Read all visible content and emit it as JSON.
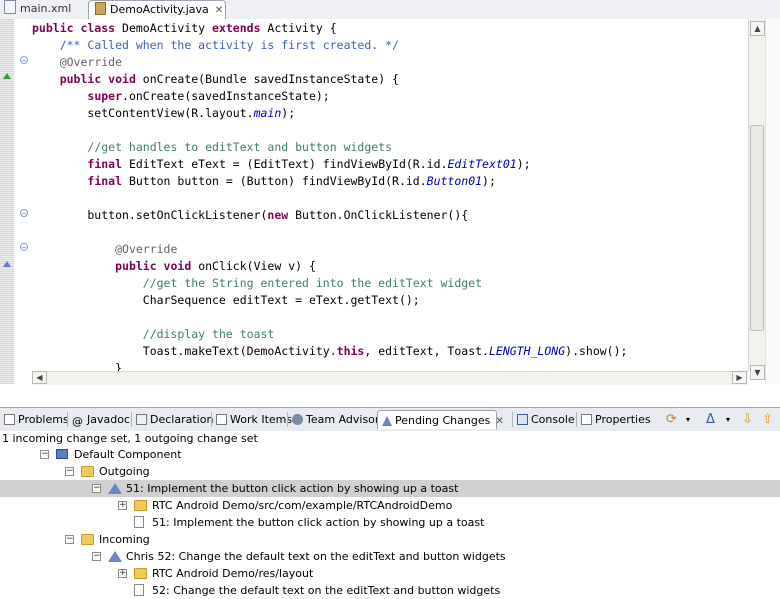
{
  "editor_tabs": [
    {
      "label": "main.xml"
    },
    {
      "label": "DemoActivity.java"
    }
  ],
  "code_lines": [
    [
      {
        "t": "public class",
        "c": "kw"
      },
      {
        "t": " DemoActivity "
      },
      {
        "t": "extends",
        "c": "kw"
      },
      {
        "t": " Activity {"
      }
    ],
    [
      {
        "t": "    "
      },
      {
        "t": "/** Called when the activity is first created. */",
        "c": "jd"
      }
    ],
    [
      {
        "t": "    "
      },
      {
        "t": "@Override",
        "c": "an"
      }
    ],
    [
      {
        "t": "    "
      },
      {
        "t": "public void",
        "c": "kw"
      },
      {
        "t": " onCreate(Bundle savedInstanceState) {"
      }
    ],
    [
      {
        "t": "        "
      },
      {
        "t": "super",
        "c": "kw"
      },
      {
        "t": ".onCreate(savedInstanceState);"
      }
    ],
    [
      {
        "t": "        setContentView(R.layout."
      },
      {
        "t": "main",
        "c": "fi"
      },
      {
        "t": ");"
      }
    ],
    [
      {
        "t": ""
      }
    ],
    [
      {
        "t": "        "
      },
      {
        "t": "//get handles to editText and button widgets",
        "c": "cm"
      }
    ],
    [
      {
        "t": "        "
      },
      {
        "t": "final",
        "c": "kw"
      },
      {
        "t": " EditText eText = (EditText) findViewById(R.id."
      },
      {
        "t": "EditText01",
        "c": "fi"
      },
      {
        "t": ");"
      }
    ],
    [
      {
        "t": "        "
      },
      {
        "t": "final",
        "c": "kw"
      },
      {
        "t": " Button button = (Button) findViewById(R.id."
      },
      {
        "t": "Button01",
        "c": "fi"
      },
      {
        "t": ");"
      }
    ],
    [
      {
        "t": ""
      }
    ],
    [
      {
        "t": "        button.setOnClickListener("
      },
      {
        "t": "new",
        "c": "kw"
      },
      {
        "t": " Button.OnClickListener(){"
      }
    ],
    [
      {
        "t": ""
      }
    ],
    [
      {
        "t": "            "
      },
      {
        "t": "@Override",
        "c": "an"
      }
    ],
    [
      {
        "t": "            "
      },
      {
        "t": "public void",
        "c": "kw"
      },
      {
        "t": " onClick(View v) {"
      }
    ],
    [
      {
        "t": "                "
      },
      {
        "t": "//get the String entered into the editText widget",
        "c": "cm"
      }
    ],
    [
      {
        "t": "                CharSequence editText = eText.getText();"
      }
    ],
    [
      {
        "t": ""
      }
    ],
    [
      {
        "t": "                "
      },
      {
        "t": "//display the toast",
        "c": "cm"
      }
    ],
    [
      {
        "t": "                Toast.makeText(DemoActivity."
      },
      {
        "t": "this",
        "c": "kw"
      },
      {
        "t": ", editText, Toast."
      },
      {
        "t": "LENGTH_LONG",
        "c": "fi"
      },
      {
        "t": ").show();"
      }
    ],
    [
      {
        "t": "            }"
      }
    ],
    [
      {
        "t": "        });"
      }
    ]
  ],
  "views_tabs": [
    {
      "label": "Problems",
      "icon": "problems-icon"
    },
    {
      "label": "Javadoc",
      "icon": "javadoc-icon"
    },
    {
      "label": "Declaration",
      "icon": "declaration-icon"
    },
    {
      "label": "Work Items",
      "icon": "work-items-icon"
    },
    {
      "label": "Team Advisor",
      "icon": "team-advisor-icon"
    },
    {
      "label": "Pending Changes",
      "icon": "pending-changes-icon"
    },
    {
      "label": "Console",
      "icon": "console-icon"
    },
    {
      "label": "Properties",
      "icon": "properties-icon"
    }
  ],
  "pending": {
    "status": "1 incoming change set, 1 outgoing change set",
    "tree": [
      {
        "label": "Default Component",
        "level": 0,
        "icon": "component-icon",
        "expand": "−"
      },
      {
        "label": "Outgoing",
        "level": 1,
        "icon": "folder-icon",
        "expand": "−"
      },
      {
        "label": "51: Implement the button click action by showing up a toast",
        "level": 2,
        "icon": "change-set-icon",
        "expand": "−",
        "selected": true
      },
      {
        "label": "RTC Android Demo/src/com/example/RTCAndroidDemo",
        "level": 3,
        "icon": "folder-icon",
        "expand": "+"
      },
      {
        "label": "51: Implement the button click action by showing up a toast",
        "level": 3,
        "icon": "work-item-icon",
        "expand": ""
      },
      {
        "label": "Incoming",
        "level": 1,
        "icon": "folder-icon",
        "expand": "−"
      },
      {
        "label": "Chris  52: Change the default text on the editText and button widgets",
        "level": 2,
        "icon": "change-set-icon",
        "expand": "−"
      },
      {
        "label": "RTC Android Demo/res/layout",
        "level": 3,
        "icon": "folder-icon",
        "expand": "+"
      },
      {
        "label": "52: Change the default text on the editText and button widgets",
        "level": 3,
        "icon": "work-item-icon",
        "expand": ""
      }
    ]
  }
}
